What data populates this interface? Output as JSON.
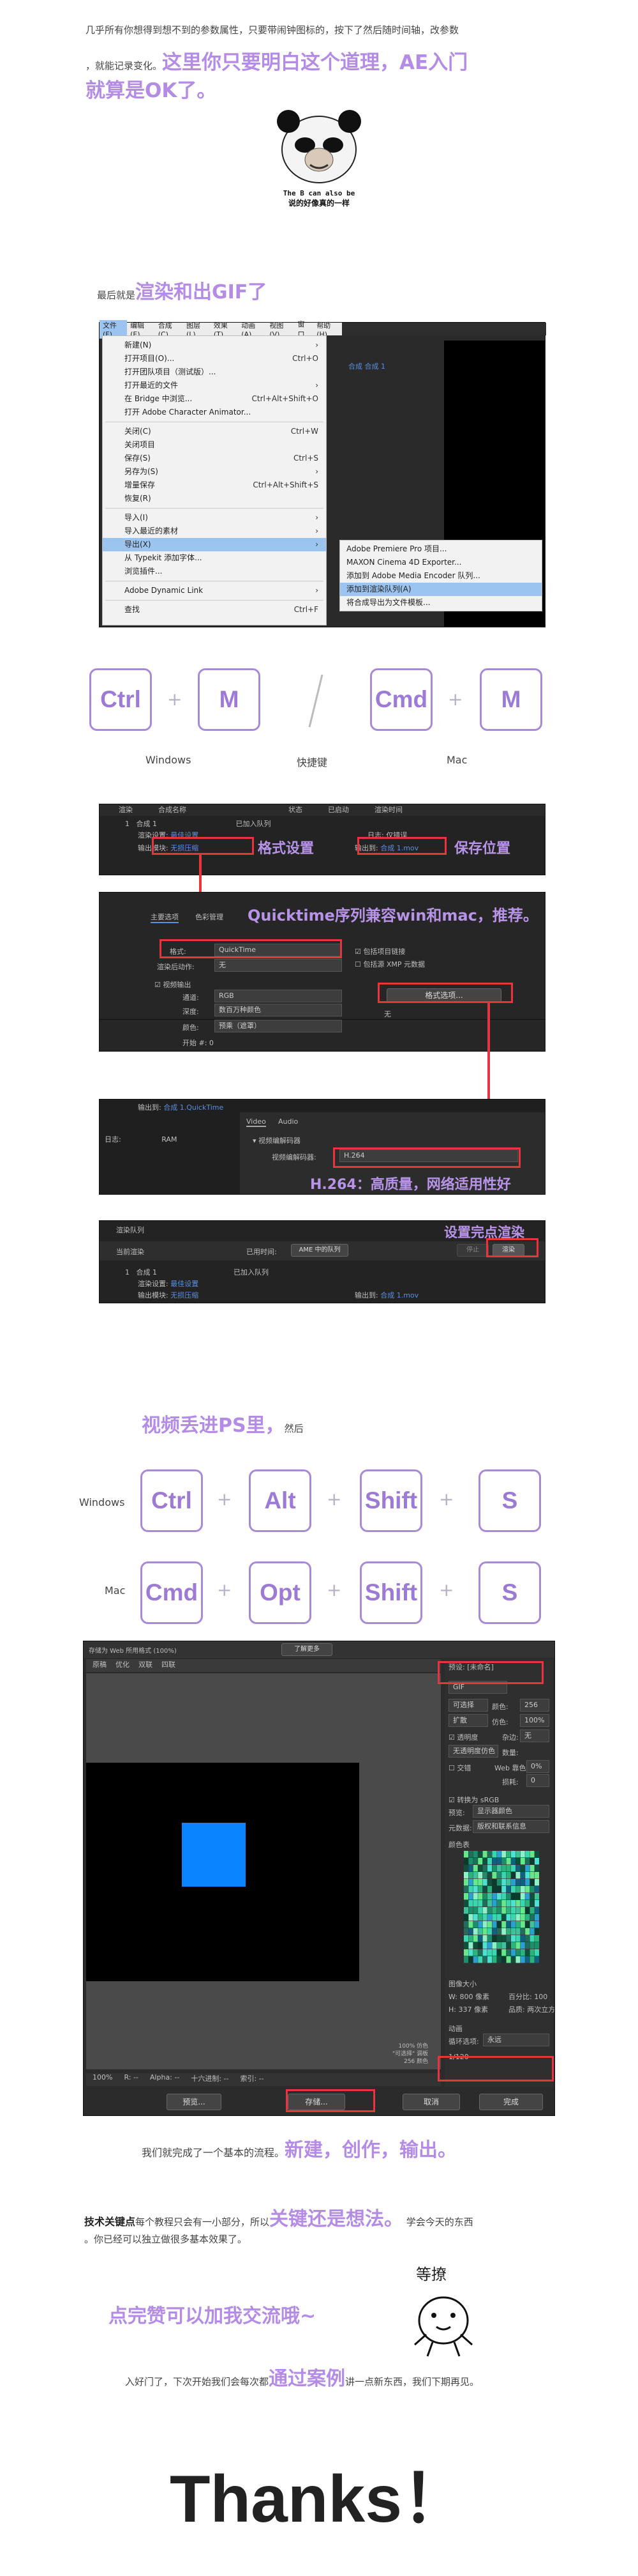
{
  "intro": {
    "line1": "几乎所有你想得到想不到的参数属性，只要带闹钟图标的，按下了然后随时间轴，改参数",
    "line2_plain": "，就能记录变化。",
    "line2_highlight": "这里你只要明白这个道理，AE入门",
    "line3_highlight": "就算是OK了。"
  },
  "meme1": {
    "caption1": "The B can also be",
    "caption2": "说的好像真的一样"
  },
  "section_render": {
    "plain": "最后就是",
    "highlight": "渲染和出GIF了"
  },
  "ae_menu": {
    "menubar": [
      "文件(F)",
      "编辑(E)",
      "合成(C)",
      "图层(L)",
      "效果(T)",
      "动画(A)",
      "视图(V)",
      "窗口",
      "帮助(H)"
    ],
    "items": [
      {
        "label": "新建(N)",
        "shortcut": ""
      },
      {
        "label": "打开项目(O)...",
        "shortcut": "Ctrl+O"
      },
      {
        "label": "打开团队项目（测试版）...",
        "shortcut": ""
      },
      {
        "label": "打开最近的文件",
        "shortcut": ""
      },
      {
        "label": "在 Bridge 中浏览...",
        "shortcut": "Ctrl+Alt+Shift+O"
      },
      {
        "label": "打开 Adobe Character Animator...",
        "shortcut": ""
      },
      {
        "label": "关闭(C)",
        "shortcut": "Ctrl+W"
      },
      {
        "label": "关闭项目",
        "shortcut": ""
      },
      {
        "label": "保存(S)",
        "shortcut": "Ctrl+S"
      },
      {
        "label": "另存为(S)",
        "shortcut": ""
      },
      {
        "label": "增量保存",
        "shortcut": "Ctrl+Alt+Shift+S"
      },
      {
        "label": "恢复(R)",
        "shortcut": ""
      },
      {
        "label": "导入(I)",
        "shortcut": ""
      },
      {
        "label": "导入最近的素材",
        "shortcut": ""
      },
      {
        "label": "导出(X)",
        "shortcut": ""
      },
      {
        "label": "从 Typekit 添加字体...",
        "shortcut": ""
      },
      {
        "label": "浏览插件...",
        "shortcut": ""
      },
      {
        "label": "Adobe Dynamic Link",
        "shortcut": ""
      },
      {
        "label": "查找",
        "shortcut": "Ctrl+F"
      }
    ],
    "submenu": [
      "Adobe Premiere Pro 项目...",
      "MAXON Cinema 4D Exporter...",
      "添加到 Adobe Media Encoder 队列...",
      "添加到渲染队列(A)",
      "将合成导出为文件模板..."
    ],
    "comp_tab": "合成",
    "comp_name": "合成 1"
  },
  "shortcut_row1": {
    "win_keys": [
      "Ctrl",
      "M"
    ],
    "mac_keys": [
      "Cmd",
      "M"
    ],
    "plus": "+",
    "slash": "/",
    "label_windows": "Windows",
    "label_shortcut": "快捷键",
    "label_mac": "Mac"
  },
  "render_queue": {
    "col_headers": [
      "渲染",
      "#",
      "合成名称",
      "状态",
      "已启动",
      "渲染时间"
    ],
    "row_num": "1",
    "row_comp": "合成 1",
    "row_status": "已加入队列",
    "render_settings_label": "渲染设置:",
    "render_settings_value": "最佳设置",
    "output_module_label": "输出模块:",
    "output_module_value": "无损压缩",
    "log_label": "日志:",
    "log_value": "仅错误",
    "output_to_label": "输出到:",
    "output_to_value": "合成 1.mov",
    "callout_format": "格式设置",
    "callout_save": "保存位置"
  },
  "output_module": {
    "tab_main": "主要选项",
    "tab_color": "色彩管理",
    "callout": "Quicktime序列兼容win和mac，推荐。",
    "format_label": "格式:",
    "format_value": "QuickTime",
    "post_render_label": "渲染后动作:",
    "post_render_value": "无",
    "include_project": "包括项目链接",
    "include_xmp": "包括源 XMP 元数据",
    "video_output": "视频输出",
    "channels_label": "通道:",
    "channels_value": "RGB",
    "depth_label": "深度:",
    "depth_value": "数百万种颜色",
    "color_label": "颜色:",
    "color_value": "预乘（遮罩）",
    "start_label": "开始 #:",
    "start_value": "0",
    "format_options_btn": "格式选项...",
    "none_label": "无"
  },
  "video_codec": {
    "tab_video": "Video",
    "tab_audio": "Audio",
    "section": "视频编解码器",
    "codec_label": "视频编解码器:",
    "codec_value": "H.264",
    "output_row": "输出到:",
    "output_value": "合成 1.QuickTime",
    "log_row": "日志:",
    "log_row_value": "RAM",
    "callout": "H.264：高质量，网络适用性好"
  },
  "render_start": {
    "callout": "设置完点渲染",
    "tab": "渲染队列",
    "current_render": "当前渲染",
    "elapsed": "已用时间:",
    "ame_btn": "AME 中的队列",
    "stop_btn": "停止",
    "pause_btn": "暂停",
    "render_btn": "渲染",
    "row_comp": "合成 1",
    "row_status": "已加入队列",
    "render_settings_value": "最佳设置",
    "output_module_value": "无损压缩",
    "output_to_value": "合成 1.mov"
  },
  "ps_section": {
    "highlight": "视频丢进PS里，",
    "plain": "然后"
  },
  "shortcut_row2": {
    "win_label": "Windows",
    "win_keys": [
      "Ctrl",
      "Alt",
      "Shift",
      "S"
    ],
    "mac_label": "Mac",
    "mac_keys": [
      "Cmd",
      "Opt",
      "Shift",
      "S"
    ],
    "plus": "+"
  },
  "ps_export": {
    "title": "存储为 Web 所用格式 (100%)",
    "top_tabs": [
      "原稿",
      "优化",
      "双联",
      "四联"
    ],
    "format_value": "GIF",
    "preset_label": "预设:",
    "preset_value": "[未命名]",
    "options": [
      {
        "label": "可选择",
        "right_label": "颜色:",
        "right_value": "256"
      },
      {
        "label": "扩散",
        "right_label": "仿色:",
        "right_value": "100%"
      },
      {
        "label": "透明度",
        "right_label": "杂边:",
        "right_value": "无"
      },
      {
        "label": "无透明度仿色",
        "right_label": "数量:",
        "right_value": ""
      },
      {
        "label": "交错",
        "right_label": "Web 靠色:",
        "right_value": "0%"
      },
      {
        "label": "",
        "right_label": "损耗:",
        "right_value": "0"
      }
    ],
    "convert_srgb": "转换为 sRGB",
    "preview_label": "预览:",
    "preview_value": "显示器颜色",
    "metadata_label": "元数据:",
    "metadata_value": "版权和联系信息",
    "color_table": "颜色表",
    "image_size": "图像大小",
    "w_label": "W:",
    "w_value": "800",
    "h_label": "H:",
    "h_value": "337",
    "px": "像素",
    "percent_label": "百分比:",
    "percent_value": "100",
    "quality_label": "品质:",
    "quality_value": "两次立方",
    "animation": "动画",
    "loop_label": "循环选项:",
    "loop_value": "永远",
    "frame_counter": "1/120",
    "info_line1": "100% 仿色",
    "info_line2": "\"可选择\" 调板",
    "info_line3": "256 颜色",
    "bottom_left": "GIF",
    "bottom_size": "42sec @ 56.6 Kbps",
    "bottom_zoom": "100%",
    "bottom_r": "R: --",
    "bottom_alpha": "Alpha: --",
    "bottom_hex": "十六进制: --",
    "bottom_index": "索引: --",
    "preview_btn": "预览...",
    "save_btn": "存储...",
    "cancel_btn": "取消",
    "done_btn": "完成",
    "learn_more_btn": "了解更多"
  },
  "summary": {
    "plain": "我们就完成了一个基本的流程。",
    "highlight": "新建，创作，输出。"
  },
  "keypoint": {
    "bold": "技术关键点",
    "plain1": "每个教程只会有一小部分，所以",
    "highlight": "关键还是想法。",
    "plain2": " 学会今天的东西",
    "line2": "。你已经可以独立做很多基本效果了。"
  },
  "like": {
    "text": "点完赞可以加我交流哦~",
    "meme_label": "等撩"
  },
  "next": {
    "plain1": "入好门了，下次开始我们会每次都",
    "highlight": "通过案例",
    "plain2": "讲一点新东西，我们下期再见。"
  },
  "thanks": "Thanks！",
  "colors": {
    "accent_purple": "#b48ce6",
    "key_border": "#a889d6",
    "red": "#e8343f",
    "ae_dark": "#232323",
    "ae_blue": "#5b8fe0",
    "blue_square": "#0a84ff"
  }
}
